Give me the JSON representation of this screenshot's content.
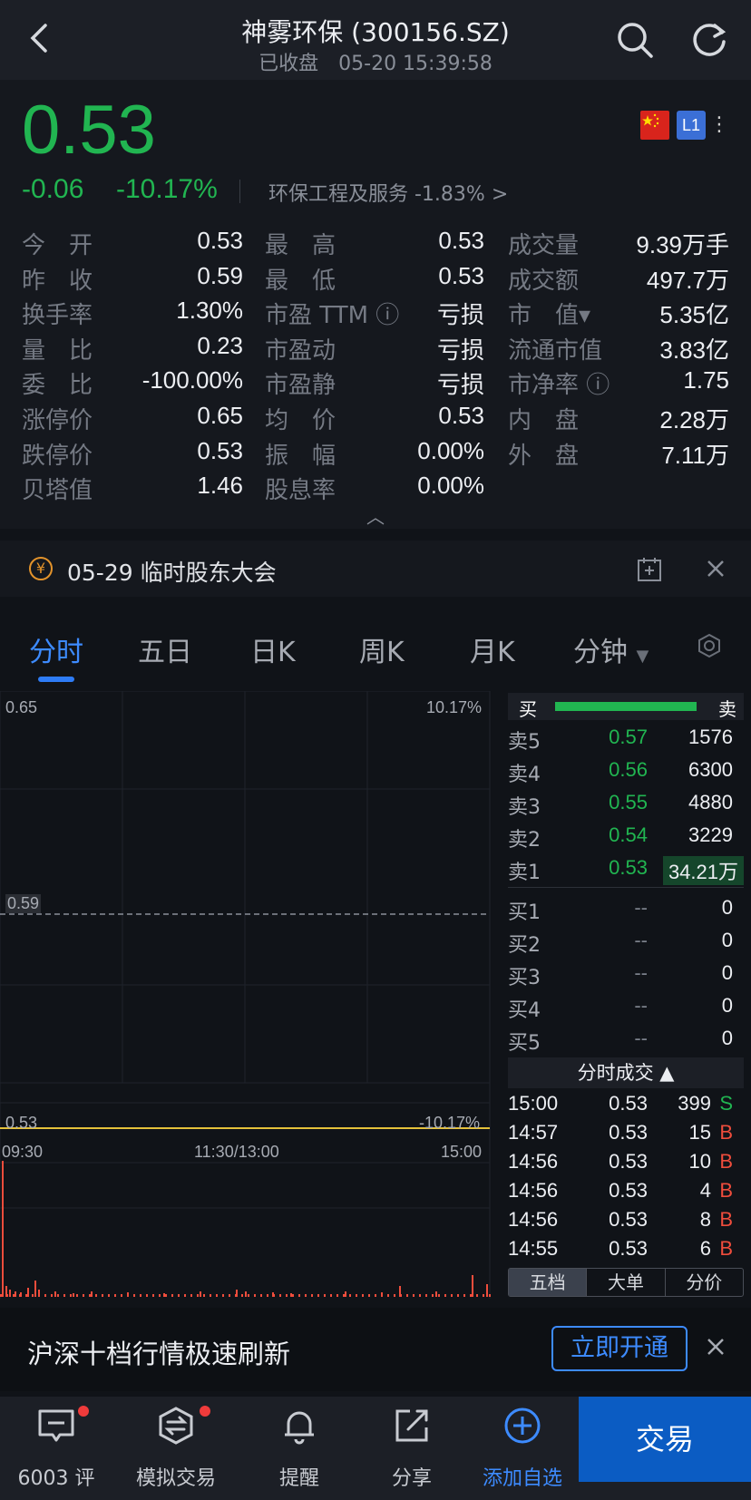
{
  "header": {
    "title": "神雾环保 (300156.SZ)",
    "status": "已收盘",
    "datetime": "05-20 15:39:58"
  },
  "quote": {
    "price": "0.53",
    "change": "-0.06",
    "change_pct": "-10.17%",
    "level_badge": "L1",
    "sector": "环保工程及服务 -1.83% >"
  },
  "stats": {
    "col1": [
      {
        "label": "今　开",
        "value": "0.53",
        "color": "white"
      },
      {
        "label": "昨　收",
        "value": "0.59",
        "color": "white"
      },
      {
        "label": "换手率",
        "value": "1.30%",
        "color": "white"
      },
      {
        "label": "量　比",
        "value": "0.23",
        "color": "white"
      },
      {
        "label": "委　比",
        "value": "-100.00%",
        "color": "white"
      },
      {
        "label": "涨停价",
        "value": "0.65",
        "color": "white"
      },
      {
        "label": "跌停价",
        "value": "0.53",
        "color": "white"
      },
      {
        "label": "贝塔值",
        "value": "1.46",
        "color": "white"
      }
    ],
    "col2": [
      {
        "label": "最　高",
        "value": "0.53"
      },
      {
        "label": "最　低",
        "value": "0.53"
      },
      {
        "label": "市盈 TTM ⓘ",
        "value": "亏损"
      },
      {
        "label": "市盈动",
        "value": "亏损"
      },
      {
        "label": "市盈静",
        "value": "亏损"
      },
      {
        "label": "均　价",
        "value": "0.53"
      },
      {
        "label": "振　幅",
        "value": "0.00%"
      },
      {
        "label": "股息率",
        "value": "0.00%"
      }
    ],
    "col3": [
      {
        "label": "成交量",
        "value": "9.39万手"
      },
      {
        "label": "成交额",
        "value": "497.7万"
      },
      {
        "label": "市　值▾",
        "value": "5.35亿"
      },
      {
        "label": "流通市值",
        "value": "3.83亿"
      },
      {
        "label": "市净率 ⓘ",
        "value": "1.75"
      },
      {
        "label": "内　盘",
        "value": "2.28万"
      },
      {
        "label": "外　盘",
        "value": "7.11万"
      }
    ]
  },
  "notice": {
    "text": "05-29 临时股东大会"
  },
  "tabs": [
    "分时",
    "五日",
    "日K",
    "周K",
    "月K",
    "分钟"
  ],
  "chart": {
    "y_top": "0.65",
    "y_mid": "0.59",
    "y_bot": "0.53",
    "pct_top": "10.17%",
    "pct_bot": "-10.17%",
    "x_start": "09:30",
    "x_mid": "11:30/13:00",
    "x_end": "15:00"
  },
  "orderbook": {
    "buy_label": "买",
    "sell_label": "卖",
    "asks": [
      {
        "label": "卖5",
        "price": "0.57",
        "vol": "1576"
      },
      {
        "label": "卖4",
        "price": "0.56",
        "vol": "6300"
      },
      {
        "label": "卖3",
        "price": "0.55",
        "vol": "4880"
      },
      {
        "label": "卖2",
        "price": "0.54",
        "vol": "3229"
      },
      {
        "label": "卖1",
        "price": "0.53",
        "vol": "34.21万"
      }
    ],
    "bids": [
      {
        "label": "买1",
        "price": "--",
        "vol": "0"
      },
      {
        "label": "买2",
        "price": "--",
        "vol": "0"
      },
      {
        "label": "买3",
        "price": "--",
        "vol": "0"
      },
      {
        "label": "买4",
        "price": "--",
        "vol": "0"
      },
      {
        "label": "买5",
        "price": "--",
        "vol": "0"
      }
    ],
    "ticks_title": "分时成交 ▲",
    "ticks": [
      {
        "time": "15:00",
        "price": "0.53",
        "vol": "399",
        "side": "S"
      },
      {
        "time": "14:57",
        "price": "0.53",
        "vol": "15",
        "side": "B"
      },
      {
        "time": "14:56",
        "price": "0.53",
        "vol": "10",
        "side": "B"
      },
      {
        "time": "14:56",
        "price": "0.53",
        "vol": "4",
        "side": "B"
      },
      {
        "time": "14:56",
        "price": "0.53",
        "vol": "8",
        "side": "B"
      },
      {
        "time": "14:55",
        "price": "0.53",
        "vol": "6",
        "side": "B"
      }
    ],
    "tabs": [
      "五档",
      "大单",
      "分价"
    ]
  },
  "banner": {
    "text": "沪深十档行情极速刷新",
    "button": "立即开通"
  },
  "bottom": {
    "items": [
      {
        "label": "6003 评",
        "icon": "comment-icon"
      },
      {
        "label": "模拟交易",
        "icon": "simulated-trade-icon"
      },
      {
        "label": "提醒",
        "icon": "bell-icon"
      },
      {
        "label": "分享",
        "icon": "share-icon"
      },
      {
        "label": "添加自选",
        "icon": "add-watchlist-icon"
      }
    ],
    "trade": "交易"
  },
  "colors": {
    "down": "#21b551",
    "up": "#ef4d3c",
    "accent": "#3d8bff"
  }
}
